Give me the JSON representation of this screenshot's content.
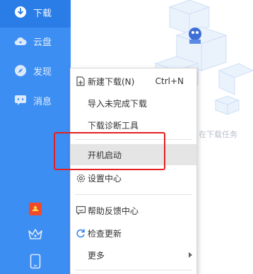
{
  "sidebar": {
    "items": [
      {
        "label": "下载",
        "icon": "download-icon",
        "active": true
      },
      {
        "label": "云盘",
        "icon": "cloud-icon"
      },
      {
        "label": "发现",
        "icon": "discover-icon"
      },
      {
        "label": "消息",
        "icon": "message-icon"
      }
    ],
    "bottom_icons": [
      "gift-icon",
      "crown-icon",
      "phone-icon"
    ]
  },
  "main": {
    "empty_hint": "在下载任务"
  },
  "context_menu": {
    "items": [
      {
        "label": "新建下载(N)",
        "shortcut": "Ctrl+N",
        "icon": "new-download-icon"
      },
      {
        "label": "导入未完成下载"
      },
      {
        "label": "下载诊断工具"
      },
      {
        "label": "开机启动",
        "highlighted": true
      },
      {
        "label": "设置中心",
        "icon": "gear-icon"
      },
      {
        "label": "帮助反馈中心",
        "icon": "feedback-icon"
      },
      {
        "label": "检查更新",
        "icon": "refresh-icon"
      },
      {
        "label": "更多",
        "has_submenu": true
      }
    ]
  },
  "colors": {
    "sidebar_bg": "#3d8ef2",
    "sidebar_active": "#2a7de6",
    "highlight_border": "#e52020",
    "accent_blue": "#2f80ed"
  }
}
